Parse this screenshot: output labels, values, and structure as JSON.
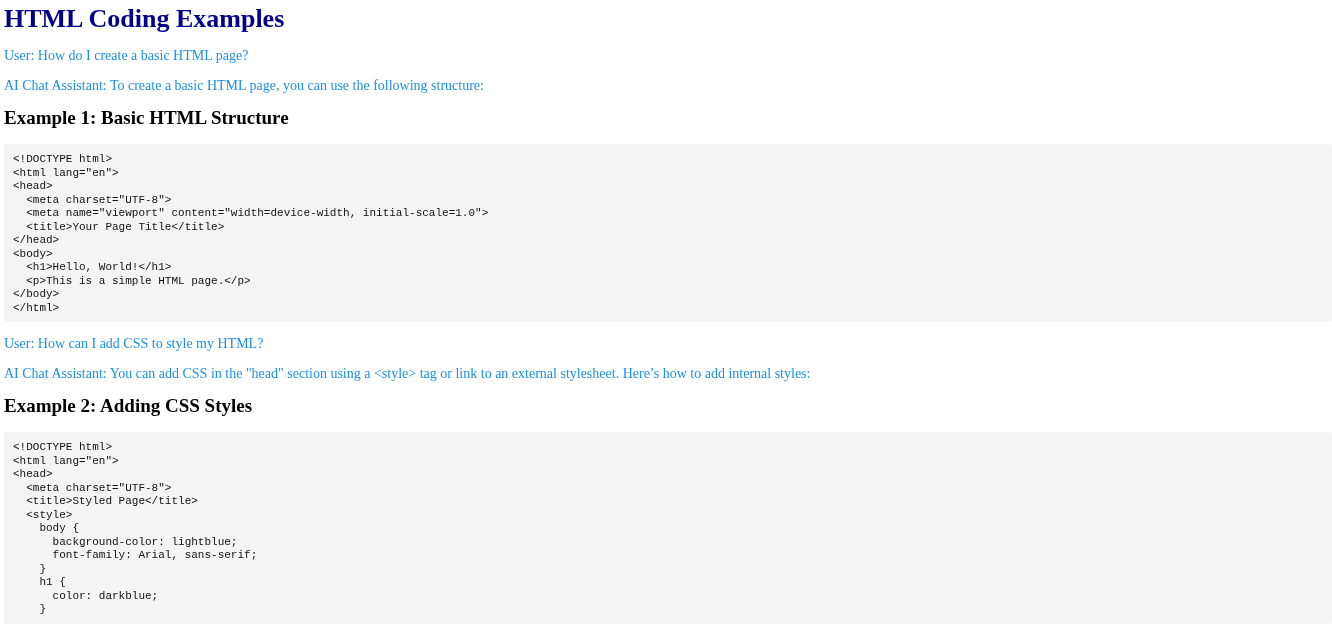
{
  "title": "HTML Coding Examples",
  "items": [
    {
      "kind": "message",
      "text": "User: How do I create a basic HTML page?"
    },
    {
      "kind": "message",
      "text": "AI Chat Assistant: To create a basic HTML page, you can use the following structure:"
    },
    {
      "kind": "heading",
      "text": "Example 1: Basic HTML Structure"
    },
    {
      "kind": "code",
      "lines": [
        "<!DOCTYPE html>",
        "<html lang=\"en\">",
        "<head>",
        "  <meta charset=\"UTF-8\">",
        "  <meta name=\"viewport\" content=\"width=device-width, initial-scale=1.0\">",
        "  <title>Your Page Title</title>",
        "</head>",
        "<body>",
        "  <h1>Hello, World!</h1>",
        "  <p>This is a simple HTML page.</p>",
        "</body>",
        "</html>"
      ]
    },
    {
      "kind": "message",
      "text": "User: How can I add CSS to style my HTML?"
    },
    {
      "kind": "message",
      "text": "AI Chat Assistant: You can add CSS in the \"head\" section using a <style> tag or link to an external stylesheet. Here’s how to add internal styles:"
    },
    {
      "kind": "heading",
      "text": "Example 2: Adding CSS Styles"
    },
    {
      "kind": "code",
      "lines": [
        "<!DOCTYPE html>",
        "<html lang=\"en\">",
        "<head>",
        "  <meta charset=\"UTF-8\">",
        "  <title>Styled Page</title>",
        "  <style>",
        "    body {",
        "      background-color: lightblue;",
        "      font-family: Arial, sans-serif;",
        "    }",
        "    h1 {",
        "      color: darkblue;",
        "    }"
      ]
    }
  ]
}
